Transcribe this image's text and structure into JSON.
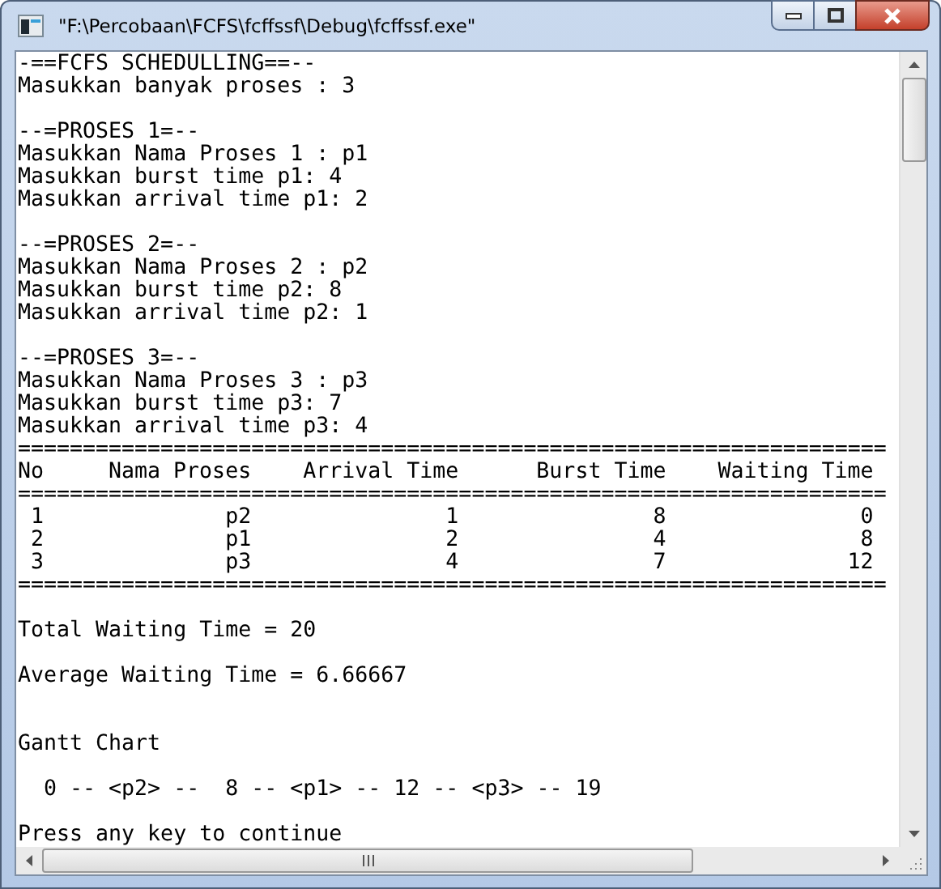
{
  "window": {
    "title": "\"F:\\Percobaan\\FCFS\\fcffssf\\Debug\\fcffssf.exe\""
  },
  "console": {
    "lines": [
      {
        "kind": "text",
        "text": "-==FCFS SCHEDULLING==--"
      },
      {
        "kind": "text",
        "text": "Masukkan banyak proses : 3"
      },
      {
        "kind": "blank"
      },
      {
        "kind": "text",
        "text": "--=PROSES 1=--"
      },
      {
        "kind": "text",
        "text": "Masukkan Nama Proses 1 : p1"
      },
      {
        "kind": "text",
        "text": "Masukkan burst time p1: 4"
      },
      {
        "kind": "text",
        "text": "Masukkan arrival time p1: 2"
      },
      {
        "kind": "blank"
      },
      {
        "kind": "text",
        "text": "--=PROSES 2=--"
      },
      {
        "kind": "text",
        "text": "Masukkan Nama Proses 2 : p2"
      },
      {
        "kind": "text",
        "text": "Masukkan burst time p2: 8"
      },
      {
        "kind": "text",
        "text": "Masukkan arrival time p2: 1"
      },
      {
        "kind": "blank"
      },
      {
        "kind": "text",
        "text": "--=PROSES 3=--"
      },
      {
        "kind": "text",
        "text": "Masukkan Nama Proses 3 : p3"
      },
      {
        "kind": "text",
        "text": "Masukkan burst time p3: 7"
      },
      {
        "kind": "text",
        "text": "Masukkan arrival time p3: 4"
      },
      {
        "kind": "rule",
        "text": "==================================================================="
      },
      {
        "kind": "header",
        "cells": [
          "No",
          "Nama Proses",
          "Arrival Time",
          "Burst Time",
          "Waiting Time"
        ]
      },
      {
        "kind": "rule",
        "text": "==================================================================="
      },
      {
        "kind": "row",
        "cells": [
          "1",
          "p2",
          "1",
          "8",
          "0"
        ]
      },
      {
        "kind": "row",
        "cells": [
          "2",
          "p1",
          "2",
          "4",
          "8"
        ]
      },
      {
        "kind": "row",
        "cells": [
          "3",
          "p3",
          "4",
          "7",
          "12"
        ]
      },
      {
        "kind": "rule",
        "text": "==================================================================="
      },
      {
        "kind": "blank"
      },
      {
        "kind": "text",
        "text": "Total Waiting Time = 20"
      },
      {
        "kind": "blank"
      },
      {
        "kind": "text",
        "text": "Average Waiting Time = 6.66667"
      },
      {
        "kind": "blank"
      },
      {
        "kind": "blank"
      },
      {
        "kind": "text",
        "text": "Gantt Chart"
      },
      {
        "kind": "blank"
      },
      {
        "kind": "text",
        "text": "  0 -- <p2> --  8 -- <p1> -- 12 -- <p3> -- 19"
      },
      {
        "kind": "blank"
      },
      {
        "kind": "text",
        "text": "Press any key to continue"
      }
    ]
  }
}
